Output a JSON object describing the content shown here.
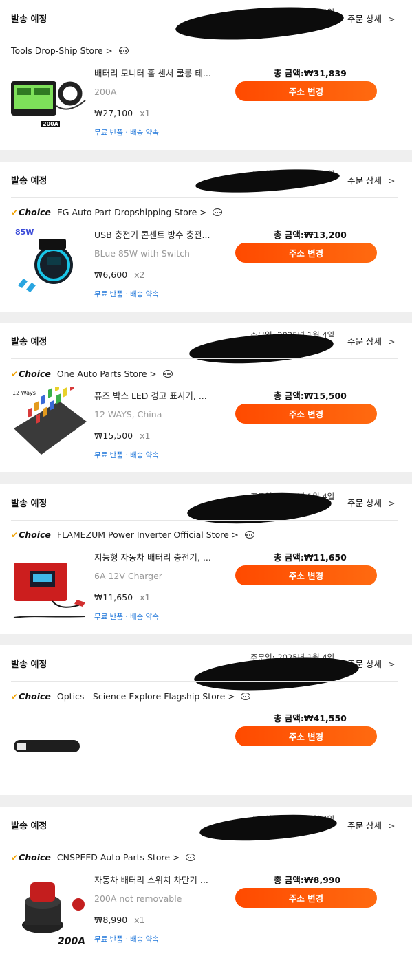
{
  "labels": {
    "status": "발송 예정",
    "order_detail": "주문 상세",
    "address_button": "주소 변경",
    "badges": "무료 반품 · 배송 약속",
    "choice": "Choice"
  },
  "orders": [
    {
      "status": "발송 예정",
      "order_date": "주문일: 2025년 1월 4일",
      "detail_label": "주문 상세",
      "choice": false,
      "store": "Tools Drop-Ship Store",
      "product_name": "배터리 모니터 홀 센서 쿨롱 테...",
      "variant": "200A",
      "price": "₩27,100",
      "quantity": "x1",
      "badges": "무료 반품 · 배송 약속",
      "total": "총 금액:₩31,839",
      "button": "주소 변경",
      "image": "battery-monitor",
      "image_text": "200A"
    },
    {
      "status": "발송 예정",
      "order_date": "주문일: 2025년 1월 4일",
      "detail_label": "주문 상세",
      "choice": true,
      "store": "EG Auto Part Dropshipping Store",
      "product_name": "USB 충전기 콘센트 방수 충전...",
      "variant": "BLue 85W with Switch",
      "price": "₩6,600",
      "quantity": "x2",
      "badges": "무료 반품 · 배송 약속",
      "total": "총 금액:₩13,200",
      "button": "주소 변경",
      "image": "usb-charger",
      "image_text": "85W"
    },
    {
      "status": "발송 예정",
      "order_date": "주문일: 2025년 1월 4일",
      "detail_label": "주문 상세",
      "choice": true,
      "store": "One Auto Parts Store",
      "product_name": "퓨즈 박스 LED 경고 표시기, ...",
      "variant": "12 WAYS, China",
      "price": "₩15,500",
      "quantity": "x1",
      "badges": "무료 반품 · 배송 약속",
      "total": "총 금액:₩15,500",
      "button": "주소 변경",
      "image": "fuse-box",
      "image_text": "12 Ways"
    },
    {
      "status": "발송 예정",
      "order_date": "주문일: 2025년 1월 4일",
      "detail_label": "주문 상세",
      "choice": true,
      "store": "FLAMEZUM Power Inverter Official Store",
      "product_name": "지능형 자동차 배터리 충전기, ...",
      "variant": "6A 12V Charger",
      "price": "₩11,650",
      "quantity": "x1",
      "badges": "무료 반품 · 배송 약속",
      "total": "총 금액:₩11,650",
      "button": "주소 변경",
      "image": "battery-charger",
      "image_text": ""
    },
    {
      "status": "발송 예정",
      "order_date": "주문일: 2025년 1월 4일",
      "detail_label": "주문 상세",
      "choice": true,
      "store": "Optics - Science Explore Flagship Store",
      "product_name": "",
      "variant": "",
      "price": "",
      "quantity": "",
      "badges": "",
      "total": "총 금액:₩41,550",
      "button": "주소 변경",
      "image": "velcro-straps",
      "image_text": ""
    },
    {
      "status": "발송 예정",
      "order_date": "주문일: 2025년 1월 4일",
      "detail_label": "주문 상세",
      "choice": true,
      "store": "CNSPEED Auto Parts Store",
      "product_name": "자동차 배터리 스위치 차단기 ...",
      "variant": "200A not removable",
      "price": "₩8,990",
      "quantity": "x1",
      "badges": "무료 반품 · 배송 약속",
      "total": "총 금액:₩8,990",
      "button": "주소 변경",
      "image": "battery-switch",
      "image_text": "200A"
    }
  ]
}
